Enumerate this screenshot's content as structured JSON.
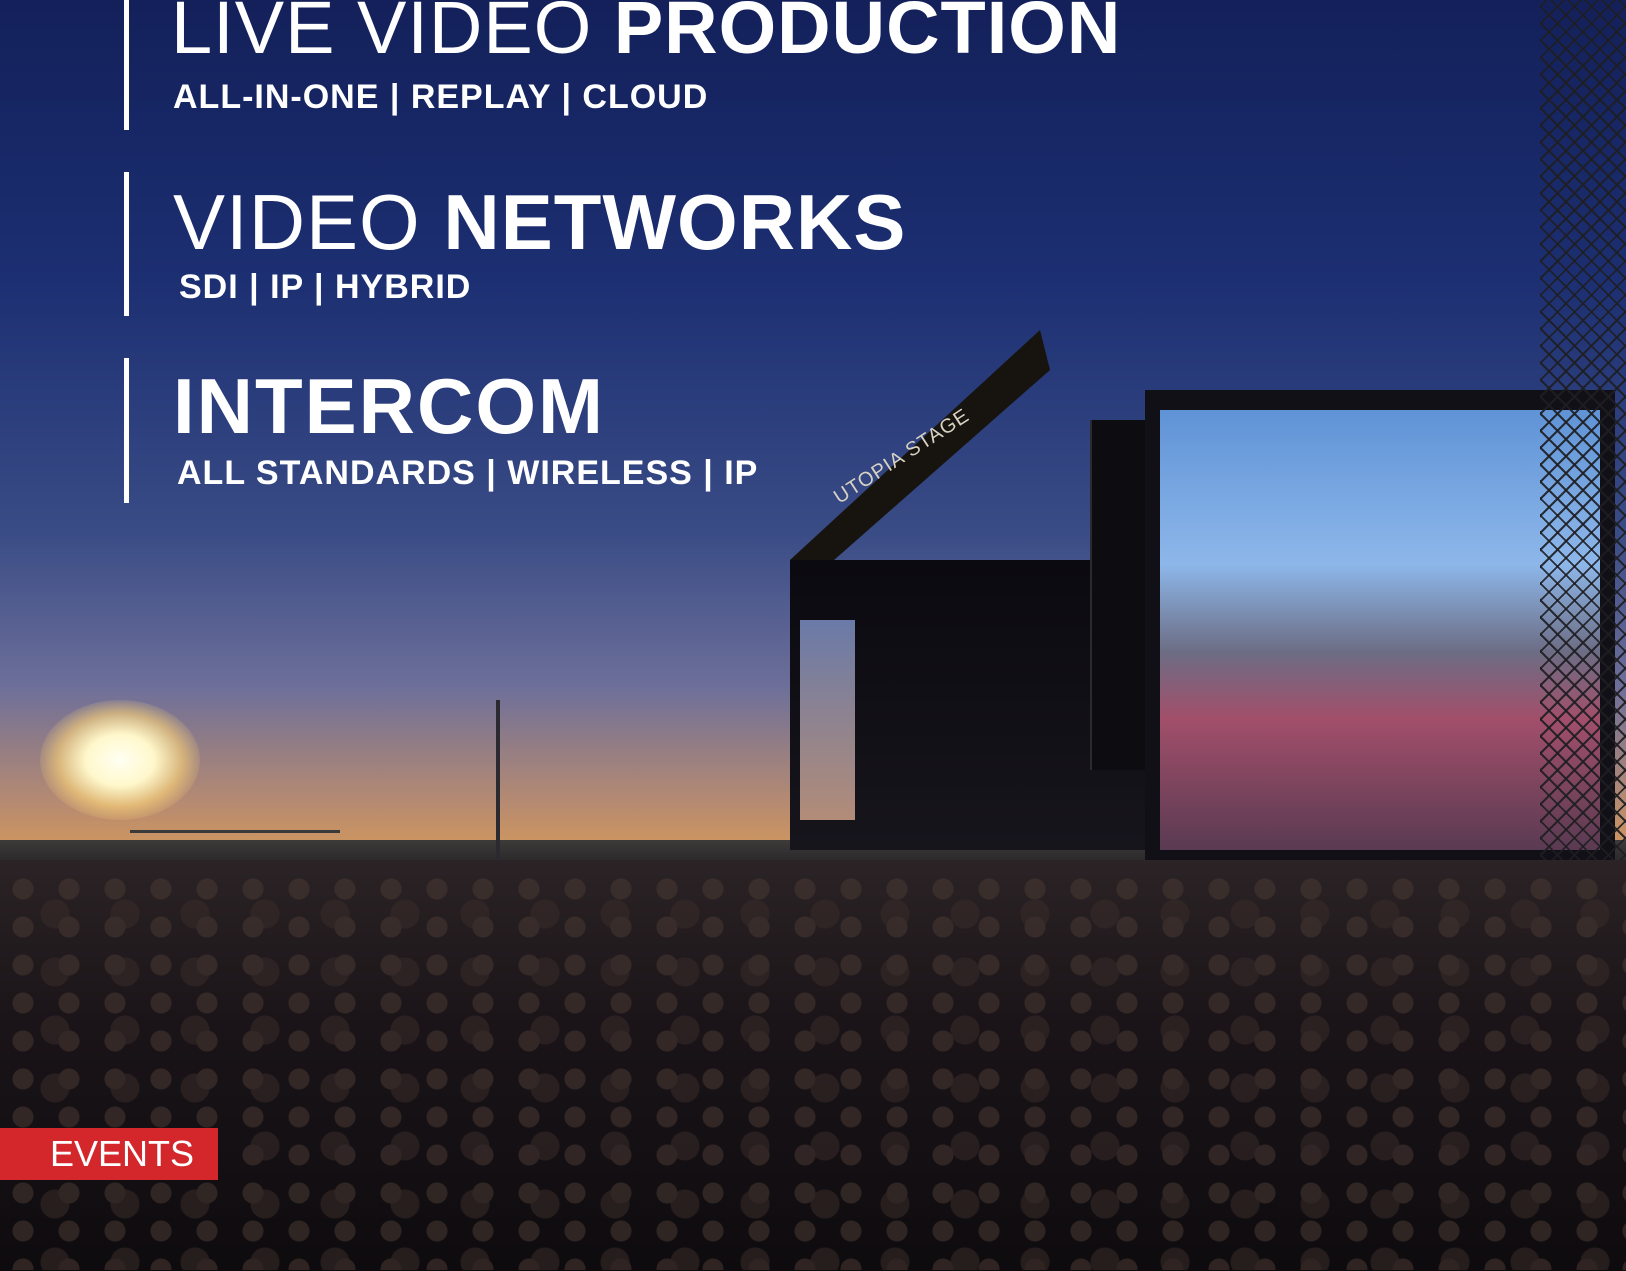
{
  "headlines": [
    {
      "light": "LIVE VIDEO ",
      "bold": "PRODUCTION",
      "sub": "ALL-IN-ONE | REPLAY | CLOUD"
    },
    {
      "light": "VIDEO ",
      "bold": "NETWORKS",
      "sub": "SDI | IP | HYBRID"
    },
    {
      "light": "",
      "bold": "INTERCOM",
      "sub": "ALL STANDARDS | WIRELESS | IP"
    }
  ],
  "photo": {
    "stage_sign": "UTOPIA STAGE"
  },
  "tag": {
    "label": "EVENTS",
    "color": "#d3272c"
  },
  "colors": {
    "text": "#ffffff",
    "sky_top": "#13205a"
  }
}
